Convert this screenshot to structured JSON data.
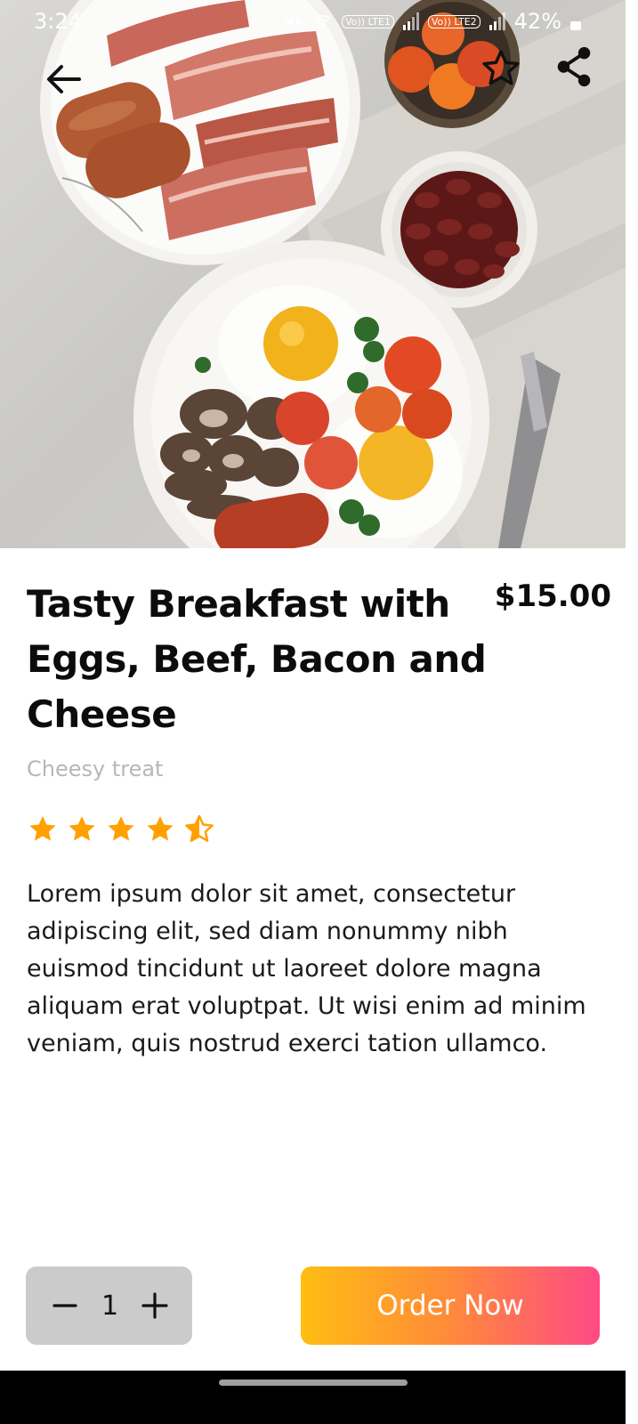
{
  "status_bar": {
    "time": "3:24",
    "sim1_label": "Vo)) LTE1",
    "sim2_label": "Vo)) LTE2",
    "battery": "42%"
  },
  "product": {
    "title": "Tasty Breakfast with Eggs, Beef, Bacon and Cheese",
    "price": "$15.00",
    "subtitle": "Cheesy treat",
    "rating": 4.5,
    "rating_max": 5,
    "description": "Lorem ipsum dolor sit amet, consectetur adipiscing elit, sed diam nonummy nibh euismod tincidunt ut laoreet dolore magna aliquam erat voluptpat. Ut wisi enim ad minim veniam, quis nostrud exerci tation ullamco."
  },
  "order": {
    "quantity": "1",
    "button_label": "Order Now"
  },
  "colors": {
    "star": "#ffa000",
    "order_gradient_start": "#ffbd12",
    "order_gradient_end": "#ff4a86",
    "qty_background": "#cbcbcb"
  },
  "icons": {
    "back": "arrow-left-icon",
    "favorite": "star-outline-icon",
    "share": "share-icon",
    "minus": "minus-icon",
    "plus": "plus-icon"
  }
}
